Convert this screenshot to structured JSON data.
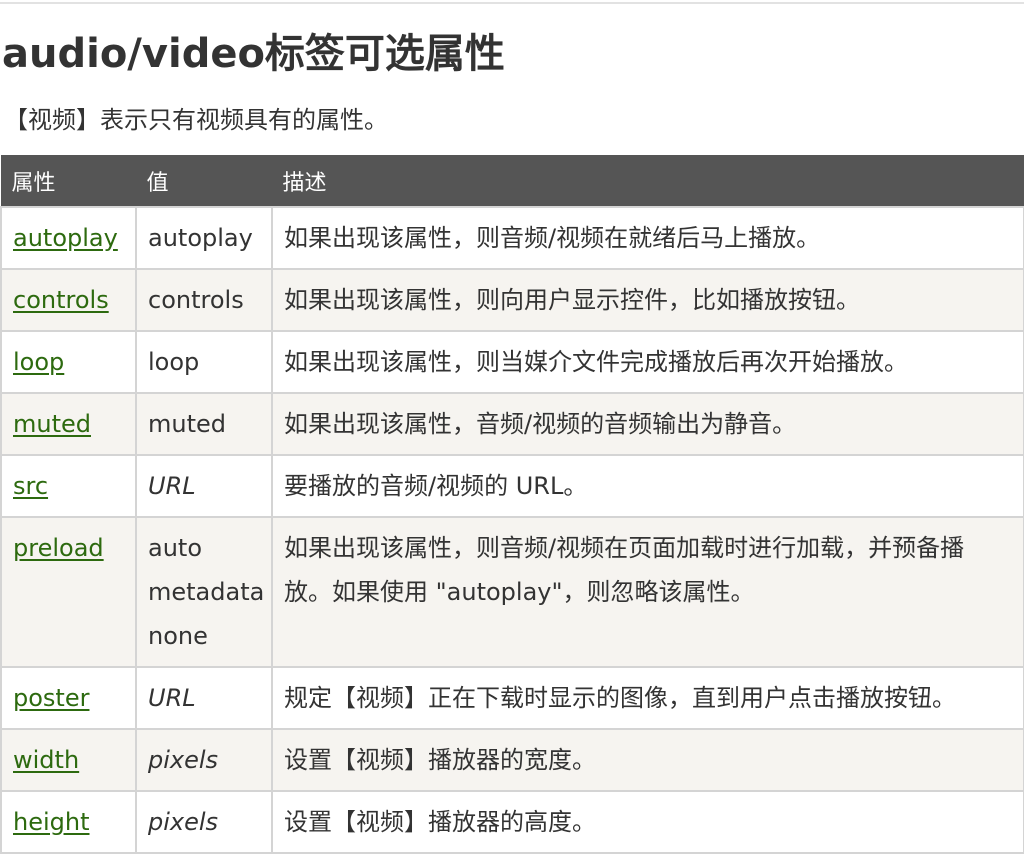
{
  "page": {
    "title": "audio/video标签可选属性",
    "intro": "【视频】表示只有视频具有的属性。"
  },
  "table": {
    "headers": [
      "属性",
      "值",
      "描述"
    ],
    "rows": [
      {
        "attr": "autoplay",
        "values": [
          "autoplay"
        ],
        "value_italic": false,
        "desc": "如果出现该属性，则音频/视频在就绪后马上播放。"
      },
      {
        "attr": "controls",
        "values": [
          "controls"
        ],
        "value_italic": false,
        "desc": "如果出现该属性，则向用户显示控件，比如播放按钮。"
      },
      {
        "attr": "loop",
        "values": [
          "loop"
        ],
        "value_italic": false,
        "desc": "如果出现该属性，则当媒介文件完成播放后再次开始播放。"
      },
      {
        "attr": "muted",
        "values": [
          "muted"
        ],
        "value_italic": false,
        "desc": "如果出现该属性，音频/视频的音频输出为静音。"
      },
      {
        "attr": "src",
        "values": [
          "URL"
        ],
        "value_italic": true,
        "desc": "要播放的音频/视频的 URL。"
      },
      {
        "attr": "preload",
        "values": [
          "auto",
          "metadata",
          "none"
        ],
        "value_italic": false,
        "desc": "如果出现该属性，则音频/视频在页面加载时进行加载，并预备播放。如果使用 \"autoplay\"，则忽略该属性。"
      },
      {
        "attr": "poster",
        "values": [
          "URL"
        ],
        "value_italic": true,
        "desc": "规定【视频】正在下载时显示的图像，直到用户点击播放按钮。"
      },
      {
        "attr": "width",
        "values": [
          "pixels"
        ],
        "value_italic": true,
        "desc": "设置【视频】播放器的宽度。"
      },
      {
        "attr": "height",
        "values": [
          "pixels"
        ],
        "value_italic": true,
        "desc": "设置【视频】播放器的高度。"
      }
    ]
  }
}
